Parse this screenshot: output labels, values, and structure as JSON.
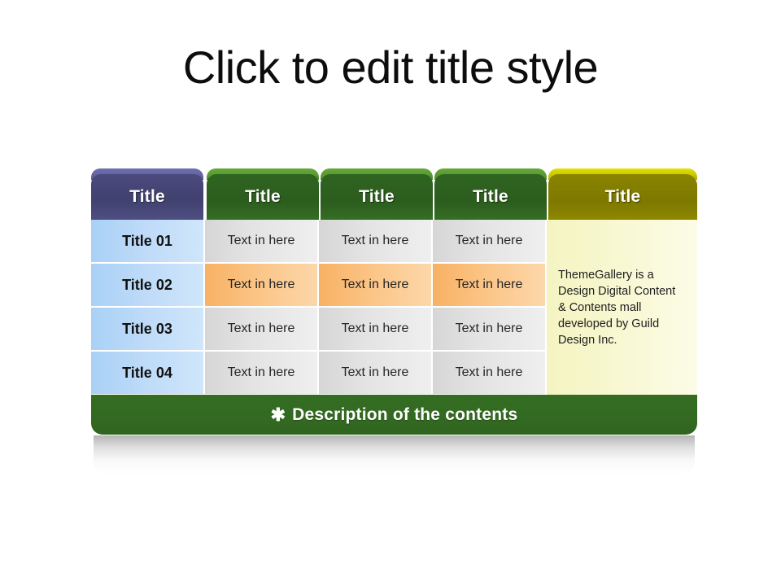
{
  "slide": {
    "title": "Click to edit title style"
  },
  "table": {
    "headers": [
      {
        "label": "Title",
        "color": "#41416f",
        "style": "purple"
      },
      {
        "label": "Title",
        "color": "#2c5d1e",
        "style": "green"
      },
      {
        "label": "Title",
        "color": "#2c5d1e",
        "style": "green"
      },
      {
        "label": "Title",
        "color": "#2c5d1e",
        "style": "green"
      },
      {
        "label": "Title",
        "color": "#7e7800",
        "style": "olive"
      }
    ],
    "rows": [
      {
        "head": "Title 01",
        "cells": [
          "Text in here",
          "Text in here",
          "Text in here"
        ],
        "fill": "grey"
      },
      {
        "head": "Title 02",
        "cells": [
          "Text in here",
          "Text in here",
          "Text in here"
        ],
        "fill": "orange"
      },
      {
        "head": "Title 03",
        "cells": [
          "Text in here",
          "Text in here",
          "Text in here"
        ],
        "fill": "grey"
      },
      {
        "head": "Title 04",
        "cells": [
          "Text in here",
          "Text in here",
          "Text in here"
        ],
        "fill": "grey"
      }
    ],
    "side_panel": {
      "text": "ThemeGallery is a Design Digital Content & Contents mall developed by Guild Design Inc."
    },
    "footer": {
      "star": "✱",
      "label": "Description of the contents"
    }
  },
  "colors": {
    "purple_tab": "#41416f",
    "purple_cap": "#5a5b95",
    "green_tab": "#2c5d1e",
    "green_cap": "#4e8f2c",
    "olive_tab": "#7e7800",
    "olive_cap": "#b5b000",
    "row_head": "#bddaf8",
    "cell_grey": "#e3e3e3",
    "cell_orange": "#fbc485",
    "side_panel": "#f7f7cf",
    "footer": "#336a21",
    "title_text": "#0d0d0d",
    "background": "#ffffff"
  }
}
